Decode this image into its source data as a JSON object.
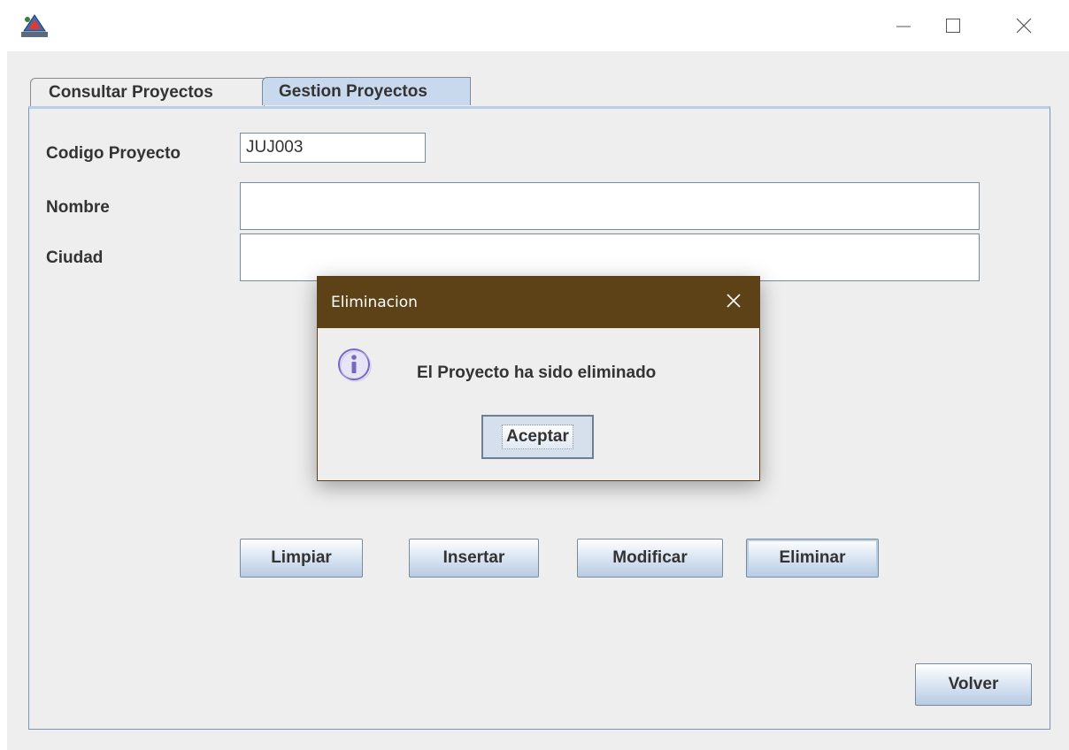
{
  "window": {
    "icon": "java-app-icon",
    "controls": {
      "minimize_icon": "minimize-icon",
      "maximize_icon": "maximize-icon",
      "close_icon": "close-icon"
    }
  },
  "tabs": [
    {
      "label": "Consultar Proyectos",
      "selected": false
    },
    {
      "label": "Gestion Proyectos",
      "selected": true
    }
  ],
  "form": {
    "codigo": {
      "label": "Codigo Proyecto",
      "value": "JUJ003"
    },
    "nombre": {
      "label": "Nombre",
      "value": ""
    },
    "ciudad": {
      "label": "Ciudad",
      "value": ""
    }
  },
  "actions": {
    "limpiar": "Limpiar",
    "insertar": "Insertar",
    "modificar": "Modificar",
    "eliminar": "Eliminar",
    "volver": "Volver"
  },
  "dialog": {
    "title": "Eliminacion",
    "message": "El Proyecto ha sido eliminado",
    "ok_label": "Aceptar",
    "icon": "info-icon"
  },
  "colors": {
    "dialog_titlebar": "#5d4218",
    "selected_tab": "#c8d9ee",
    "panel_border": "#7b94b8",
    "button_gradient_bottom": "#b7cbe3",
    "background": "#eeeeee"
  }
}
